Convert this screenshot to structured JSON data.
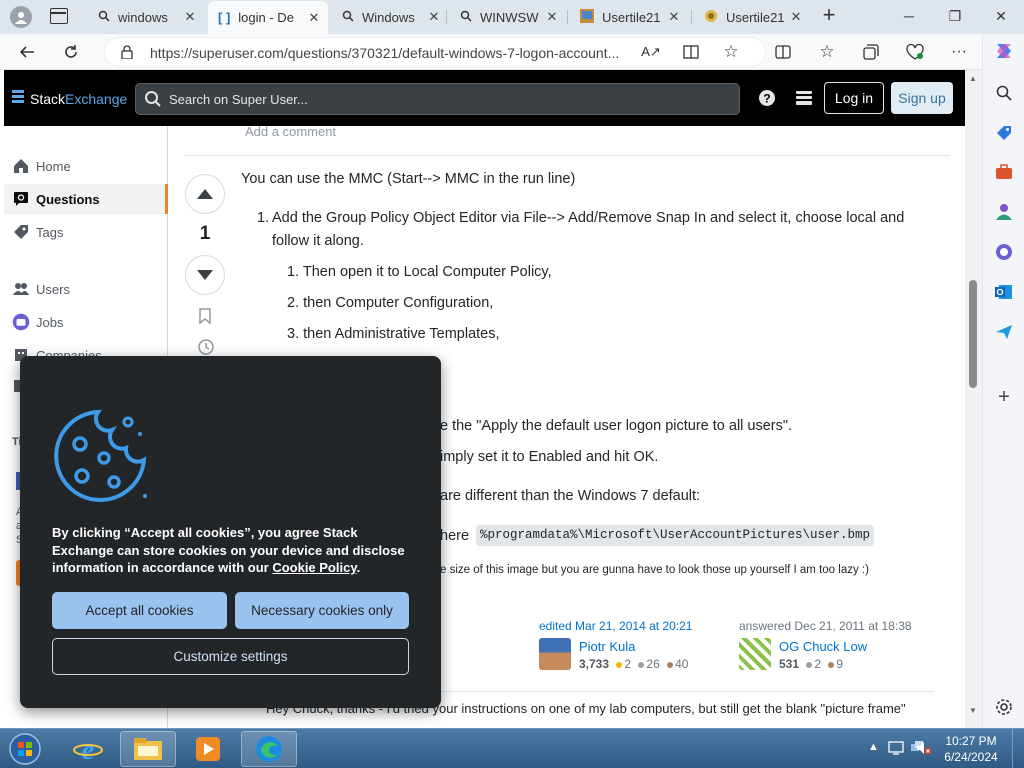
{
  "browser": {
    "tabs": [
      {
        "label": "windows",
        "icon": "search-icon"
      },
      {
        "label": "login - De",
        "icon": "superuser-icon",
        "active": true
      },
      {
        "label": "Windows",
        "icon": "search-icon"
      },
      {
        "label": "WINWSW",
        "icon": "search-icon"
      },
      {
        "label": "Usertile21",
        "icon": "image-icon"
      },
      {
        "label": "Usertile21",
        "icon": "image-icon"
      }
    ],
    "new_tab": "+",
    "url": "https://superuser.com/questions/370321/default-windows-7-logon-account..."
  },
  "header": {
    "logo_left": "Stack",
    "logo_right": "Exchange",
    "search_placeholder": "Search on Super User...",
    "login_label": "Log in",
    "signup_label": "Sign up"
  },
  "nav": {
    "home": "Home",
    "questions": "Questions",
    "tags": "Tags",
    "users": "Users",
    "jobs": "Jobs",
    "companies": "Companies",
    "partial_ti": "Ti",
    "partial_a": "A",
    "partial_a2": "a",
    "partial_s": "S"
  },
  "answer": {
    "add_comment": "Add a comment",
    "votes": "1",
    "intro": "You can use the MMC (Start--> MMC in the run line)",
    "step1_num": "1.",
    "step1_line1": "Add the Group Policy Object Editor via File--> Add/Remove Snap In and select it, choose local and",
    "step1_line2": "follow it along.",
    "sub1": "1. Then open it to Local Computer Policy,",
    "sub2": "2. then Computer Configuration,",
    "sub3": "3. then Administrative Templates,",
    "partial_apply": "e the \"Apply the default user logon picture to all users\".",
    "partial_enabled": "imply set it to Enabled and hit OK.",
    "partial_different": "are different than the Windows 7 default:",
    "partial_here": "here",
    "code_path": "%programdata%\\Microsoft\\UserAccountPictures\\user.bmp",
    "partial_lazy": "e size of this image but you are gunna have to look those up yourself I am too lazy :)"
  },
  "edited": {
    "label": "edited Mar 21, 2014 at 20:21",
    "user": "Piotr Kula",
    "rep": "3,733",
    "gold": "2",
    "silver": "26",
    "bronze": "40"
  },
  "answered": {
    "label": "answered Dec 21, 2011 at 18:38",
    "user": "OG Chuck Low",
    "rep": "531",
    "silver": "2",
    "bronze": "9"
  },
  "comment": {
    "text": "Hey Chuck, thanks - I'd tried your instructions on one of my lab computers, but still get the blank \"picture frame\""
  },
  "cookie": {
    "text_part1": "By clicking “Accept all cookies”, you agree Stack Exchange can store cookies on your device and disclose information in accordance with our ",
    "policy_link": "Cookie Policy",
    "text_end": ".",
    "accept_all": "Accept all cookies",
    "necessary_only": "Necessary cookies only",
    "customize": "Customize settings"
  },
  "taskbar": {
    "time": "10:27 PM",
    "date": "6/24/2024"
  },
  "colors": {
    "accent": "#f48225",
    "link": "#0074cc",
    "cookie_bg": "#232629",
    "cookie_btn": "#99c2ee"
  }
}
